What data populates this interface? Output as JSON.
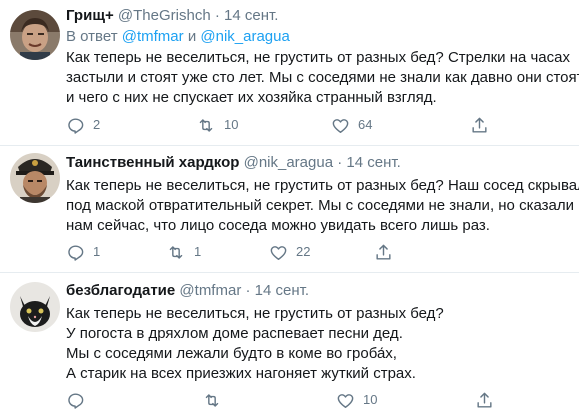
{
  "tweets": [
    {
      "name": "Грищ+",
      "handle": "@TheGrishch",
      "dot": "·",
      "date": "14 сент.",
      "reply_prefix": "В ответ",
      "reply_mention_1": "@tmfmar",
      "reply_and": "и",
      "reply_mention_2": "@nik_aragua",
      "lines": [
        "Как теперь не веселиться, не грустить от разных бед? Стрелки на часах",
        "застыли и стоят уже сто лет. Мы с соседями не знали как давно они стоят",
        "и чего с них не спускает их хозяйка странный взгляд."
      ],
      "replies": "2",
      "retweets": "10",
      "likes": "64"
    },
    {
      "name": "Таинственный хардкор",
      "handle": "@nik_aragua",
      "dot": "·",
      "date": "14 сент.",
      "lines": [
        "Как теперь не веселиться, не грустить от разных бед? Наш сосед скрывал",
        "под маской отвратительный секрет. Мы с соседями не знали, но сказали",
        "нам сейчас, что лицо соседа можно увидать всего лишь раз."
      ],
      "replies": "1",
      "retweets": "1",
      "likes": "22"
    },
    {
      "name": "безблагодатие",
      "handle": "@tmfmar",
      "dot": "·",
      "date": "14 сент.",
      "lines": [
        "Как теперь не веселиться, не грустить от разных бед?",
        "У погоста в дряхлом доме распевает песни дед.",
        "Мы с соседями лежали будто в коме во гроба́х,",
        "А старик на всех приезжих нагоняет жуткий страх."
      ],
      "replies": "",
      "retweets": "",
      "likes": "10"
    }
  ],
  "colors": {
    "name": "#14171a",
    "secondary": "#657786",
    "link": "#1da1f2",
    "divider": "#e6ecf0"
  },
  "icons": [
    "reply-icon",
    "retweet-icon",
    "like-icon",
    "share-icon"
  ]
}
